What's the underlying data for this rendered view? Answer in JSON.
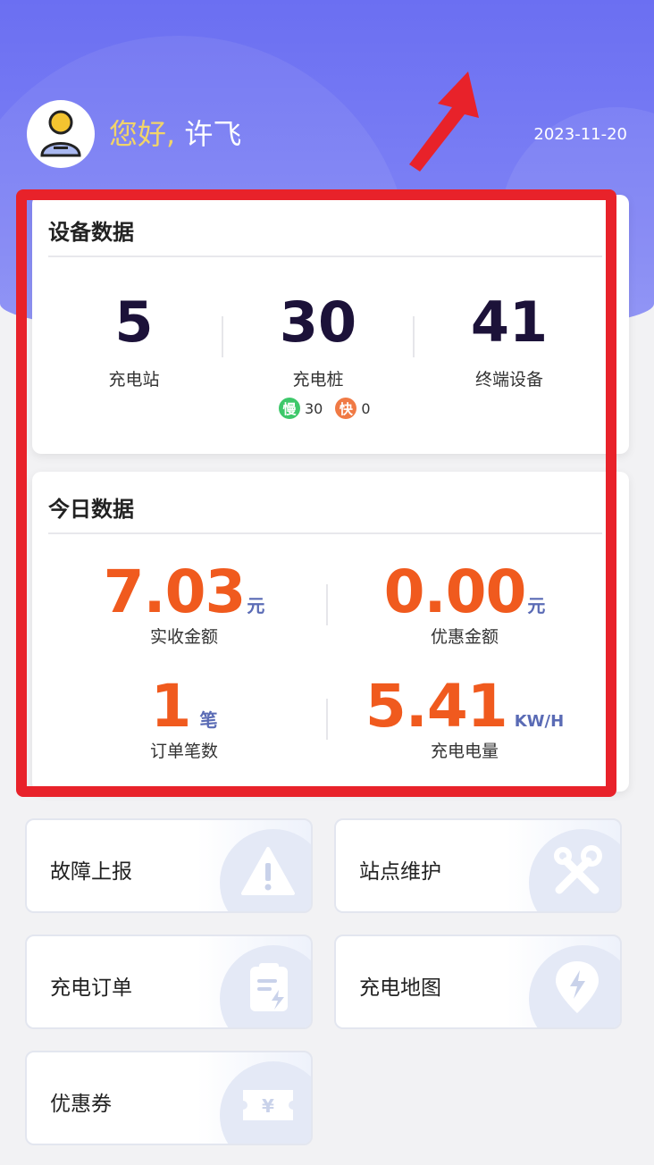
{
  "header": {
    "greeting": "您好,",
    "user_name": "许飞",
    "date": "2023-11-20"
  },
  "device_data": {
    "title": "设备数据",
    "stations": {
      "value": "5",
      "label": "充电站"
    },
    "piles": {
      "value": "30",
      "label": "充电桩"
    },
    "terminals": {
      "value": "41",
      "label": "终端设备"
    },
    "slow_badge": "慢",
    "slow_count": "30",
    "fast_badge": "快",
    "fast_count": "0"
  },
  "today_data": {
    "title": "今日数据",
    "received": {
      "value": "7.03",
      "unit": "元",
      "label": "实收金额"
    },
    "discount": {
      "value": "0.00",
      "unit": "元",
      "label": "优惠金额"
    },
    "orders": {
      "value": "1",
      "unit": "笔",
      "label": "订单笔数"
    },
    "energy": {
      "value": "5.41",
      "unit": "KW/H",
      "label": "充电电量"
    }
  },
  "tiles": [
    {
      "label": "故障上报",
      "icon": "warning-icon"
    },
    {
      "label": "站点维护",
      "icon": "wrench-tools-icon"
    },
    {
      "label": "充电订单",
      "icon": "order-document-icon"
    },
    {
      "label": "充电地图",
      "icon": "map-pin-bolt-icon"
    },
    {
      "label": "优惠券",
      "icon": "coupon-icon"
    }
  ],
  "colors": {
    "header": "#6b6ff2",
    "greeting": "#f1d469",
    "accent_orange": "#f05a1e",
    "unit_blue": "#5a6bb5",
    "annotation_red": "#e8222a"
  }
}
